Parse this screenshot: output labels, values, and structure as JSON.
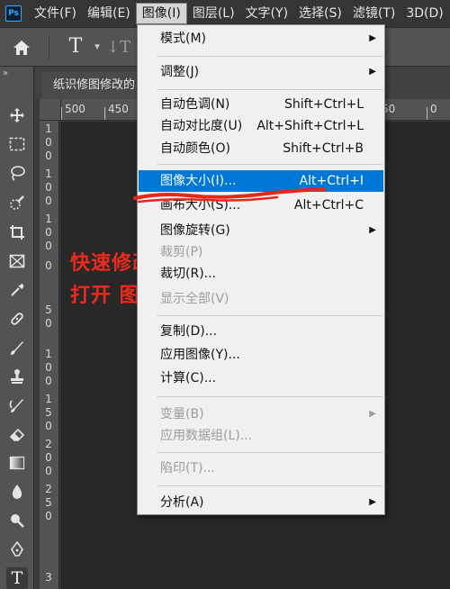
{
  "app": {
    "logo_text": "Ps"
  },
  "menubar": {
    "items": [
      {
        "label": "文件(F)"
      },
      {
        "label": "编辑(E)"
      },
      {
        "label": "图像(I)"
      },
      {
        "label": "图层(L)"
      },
      {
        "label": "文字(Y)"
      },
      {
        "label": "选择(S)"
      },
      {
        "label": "滤镜(T)"
      },
      {
        "label": "3D(D)"
      }
    ]
  },
  "options_bar": {
    "text_tool_glyph": "T",
    "orientation_glyph": "↓T"
  },
  "toolbar": {
    "collapse_glyph": "»"
  },
  "document": {
    "tab_title": "纸识修图修改的"
  },
  "ruler": {
    "h_labels": [
      "500",
      "450",
      "50",
      "0"
    ],
    "v_labels": [
      "1",
      "0",
      "0",
      "1",
      "0",
      "0",
      "1",
      "0",
      "0",
      "0",
      "5",
      "0",
      "1",
      "0",
      "0",
      "1",
      "5",
      "0",
      "2",
      "0",
      "0",
      "2",
      "5",
      "0",
      "3"
    ]
  },
  "image_menu": {
    "items": [
      {
        "label": "模式(M)",
        "shortcut": "",
        "submenu": true,
        "disabled": false
      },
      {
        "label": "调整(J)",
        "shortcut": "",
        "submenu": true,
        "disabled": false
      },
      {
        "label": "自动色调(N)",
        "shortcut": "Shift+Ctrl+L",
        "submenu": false,
        "disabled": false
      },
      {
        "label": "自动对比度(U)",
        "shortcut": "Alt+Shift+Ctrl+L",
        "submenu": false,
        "disabled": false
      },
      {
        "label": "自动颜色(O)",
        "shortcut": "Shift+Ctrl+B",
        "submenu": false,
        "disabled": false
      },
      {
        "label": "图像大小(I)...",
        "shortcut": "Alt+Ctrl+I",
        "submenu": false,
        "disabled": false,
        "highlighted": true
      },
      {
        "label": "画布大小(S)...",
        "shortcut": "Alt+Ctrl+C",
        "submenu": false,
        "disabled": false
      },
      {
        "label": "图像旋转(G)",
        "shortcut": "",
        "submenu": true,
        "disabled": false
      },
      {
        "label": "裁剪(P)",
        "shortcut": "",
        "submenu": false,
        "disabled": true
      },
      {
        "label": "裁切(R)...",
        "shortcut": "",
        "submenu": false,
        "disabled": false
      },
      {
        "label": "显示全部(V)",
        "shortcut": "",
        "submenu": false,
        "disabled": true
      },
      {
        "label": "复制(D)...",
        "shortcut": "",
        "submenu": false,
        "disabled": false
      },
      {
        "label": "应用图像(Y)...",
        "shortcut": "",
        "submenu": false,
        "disabled": false
      },
      {
        "label": "计算(C)...",
        "shortcut": "",
        "submenu": false,
        "disabled": false
      },
      {
        "label": "变量(B)",
        "shortcut": "",
        "submenu": true,
        "disabled": true
      },
      {
        "label": "应用数据组(L)...",
        "shortcut": "",
        "submenu": false,
        "disabled": true
      },
      {
        "label": "陷印(T)...",
        "shortcut": "",
        "submenu": false,
        "disabled": true
      },
      {
        "label": "分析(A)",
        "shortcut": "",
        "submenu": true,
        "disabled": false
      }
    ],
    "submenu_arrow": "▶"
  },
  "annotation": {
    "line1": "快速修改图片分辨率",
    "line2": "打开 图像大小",
    "color": "#ee2a1c"
  },
  "colors": {
    "highlight": "#0078d7",
    "menu_bg": "#f0f0f0",
    "app_bg": "#3b3b3b"
  }
}
